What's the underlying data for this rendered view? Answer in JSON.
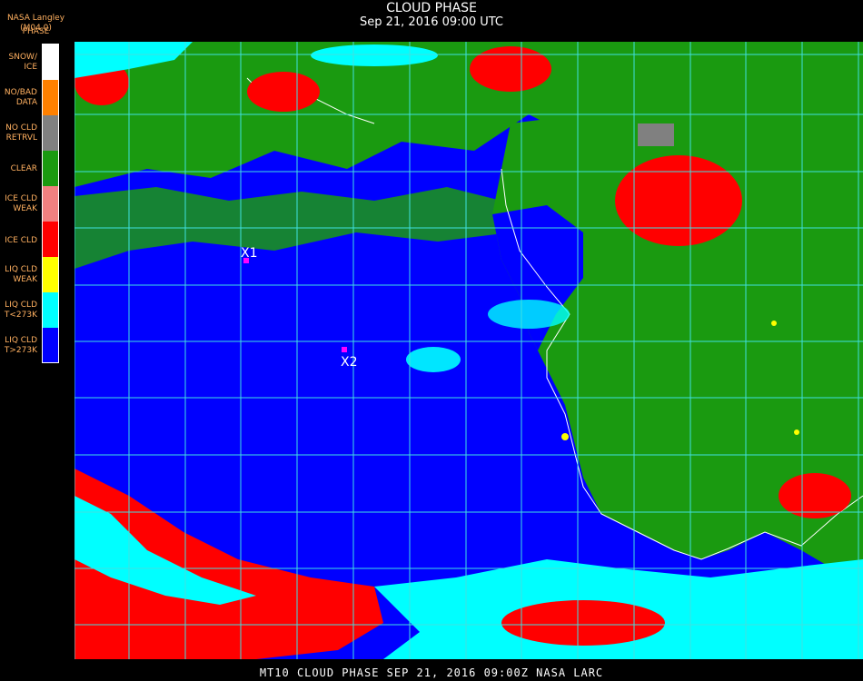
{
  "header": {
    "title": "CLOUD PHASE",
    "subtitle": "Sep 21, 2016 09:00 UTC",
    "credit": "NASA Langley (M04.0)",
    "legend_title": "PHASE"
  },
  "legend": {
    "items": [
      {
        "label": "SNOW/\nICE",
        "color": "#ffffff"
      },
      {
        "label": "NO/BAD\nDATA",
        "color": "#ff8000"
      },
      {
        "label": "NO CLD\nRETRVL",
        "color": "#808080"
      },
      {
        "label": "CLEAR",
        "color": "#1a9a10"
      },
      {
        "label": "ICE CLD\nWEAK",
        "color": "#f08080"
      },
      {
        "label": "ICE CLD",
        "color": "#ff0000"
      },
      {
        "label": "LIQ CLD\nWEAK",
        "color": "#ffff00"
      },
      {
        "label": "LIQ CLD\nT<273K",
        "color": "#00ffff"
      },
      {
        "label": "LIQ CLD\nT>273K",
        "color": "#0000ff"
      }
    ]
  },
  "markers": [
    {
      "label": "X1",
      "color": "#ff00ff"
    },
    {
      "label": "X2",
      "color": "#ff00ff"
    }
  ],
  "footer": {
    "text": "MT10   CLOUD PHASE   SEP 21, 2016 09:00Z   NASA LARC"
  },
  "colors": {
    "ocean_liquid": "#0000ff",
    "land_clear": "#1a9a10",
    "ice": "#ff0000",
    "liquid_cold": "#00ffff",
    "grid": "#40e0e0",
    "coast": "#ffffff"
  }
}
